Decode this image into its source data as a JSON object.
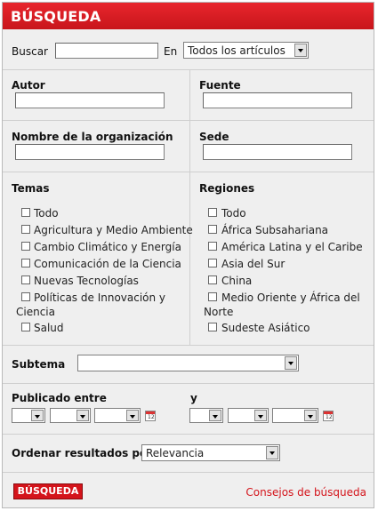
{
  "header": {
    "title": "BÚSQUEDA"
  },
  "search": {
    "label": "Buscar",
    "value": "",
    "in_label": "En",
    "in_selected": "Todos los artículos"
  },
  "fields": {
    "author_label": "Autor",
    "source_label": "Fuente",
    "org_label": "Nombre de la organización",
    "headquarters_label": "Sede"
  },
  "themes": {
    "label": "Temas",
    "items": [
      "Todo",
      "Agricultura y Medio Ambiente",
      "Cambio Climático y Energía",
      "Comunicación de la Ciencia",
      "Nuevas Tecnologías",
      "Políticas de Innovación y",
      "Ciencia",
      "Salud"
    ]
  },
  "regions": {
    "label": "Regiones",
    "items": [
      "Todo",
      "África Subsahariana",
      "América Latina y el Caribe",
      "Asia del Sur",
      "China",
      "Medio Oriente y África del",
      "Norte",
      "Sudeste Asiático"
    ]
  },
  "subtheme": {
    "label": "Subtema",
    "selected": ""
  },
  "published": {
    "label": "Publicado entre",
    "and_label": "y",
    "cal_icon_text": "12"
  },
  "sort": {
    "label": "Ordenar resultados por",
    "selected": "Relevancia"
  },
  "actions": {
    "search_button": "BÚSQUEDA",
    "tips_link": "Consejos de búsqueda"
  },
  "colors": {
    "accent": "#d4141b",
    "panel": "#efefef"
  },
  "icons": {
    "calendar": "calendar-icon",
    "dropdown": "chevron-down-icon"
  }
}
